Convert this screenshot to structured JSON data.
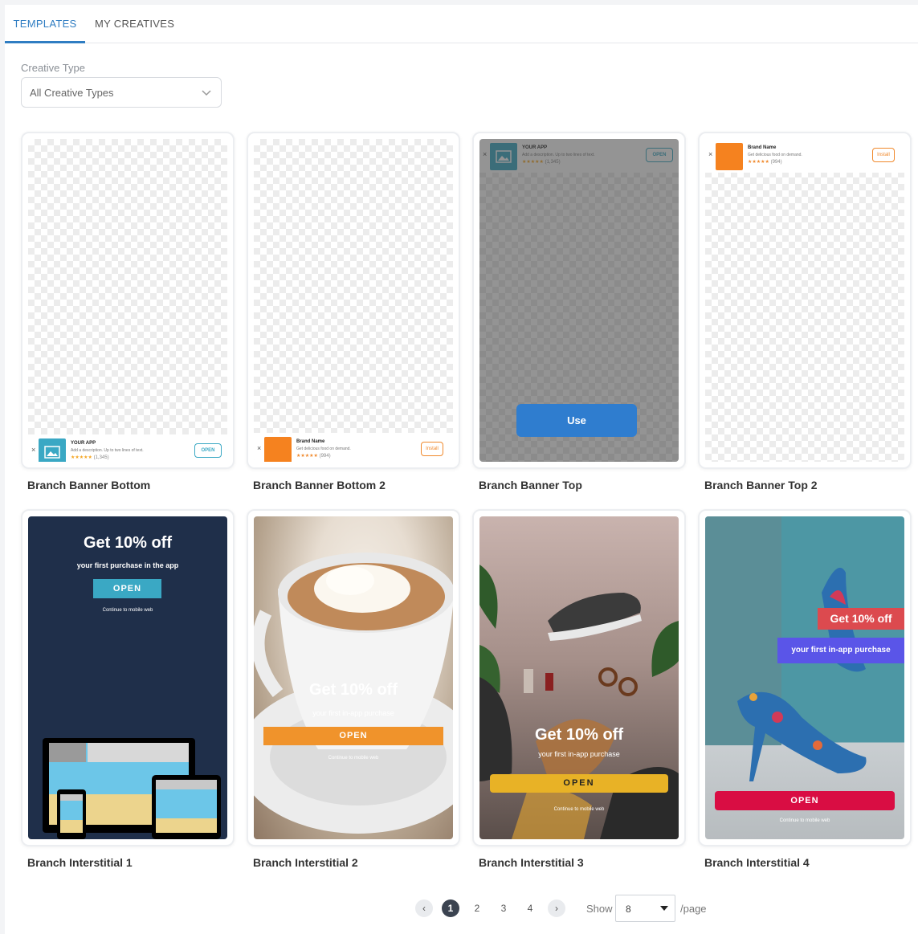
{
  "tabs": [
    {
      "label": "TEMPLATES",
      "active": true
    },
    {
      "label": "MY CREATIVES",
      "active": false
    }
  ],
  "filter": {
    "label": "Creative Type",
    "value": "All Creative Types"
  },
  "banners": {
    "your_app": {
      "close": "×",
      "name": "YOUR APP",
      "desc": "Add a description. Up to two lines of text.",
      "stars": "★★★★★",
      "count": "(1,345)",
      "button": "OPEN"
    },
    "brand": {
      "close": "×",
      "name": "Brand Name",
      "desc": "Get delicious food on demand.",
      "stars": "★★★★★",
      "count": "(994)",
      "button": "Install"
    }
  },
  "use_button": "Use",
  "templates": [
    {
      "title": "Branch Banner Bottom"
    },
    {
      "title": "Branch Banner Bottom 2"
    },
    {
      "title": "Branch Banner Top"
    },
    {
      "title": "Branch Banner Top 2"
    },
    {
      "title": "Branch Interstitial 1",
      "headline": "Get 10% off",
      "sub": "your first purchase in the app",
      "cta": "OPEN",
      "link": "Continue to mobile web"
    },
    {
      "title": "Branch Interstitial 2",
      "headline": "Get 10% off",
      "sub": "your first in-app purchase",
      "cta": "OPEN",
      "link": "Continue to mobile web"
    },
    {
      "title": "Branch Interstitial 3",
      "headline": "Get 10% off",
      "sub": "your first in-app purchase",
      "cta": "OPEN",
      "link": "Continue to mobile web"
    },
    {
      "title": "Branch Interstitial 4",
      "headline": "Get 10% off",
      "sub": "your first in-app purchase",
      "cta": "OPEN",
      "link": "Continue to mobile web"
    }
  ],
  "pagination": {
    "pages": [
      "1",
      "2",
      "3",
      "4"
    ],
    "current": "1",
    "prev": "‹",
    "next": "›",
    "show_label": "Show",
    "per_page": "8",
    "per_page_suffix": "/page"
  },
  "colors": {
    "accent": "#2f7dc2",
    "use_button": "#2f7dcf",
    "interstitial1_bg": "#1f2f4a",
    "interstitial1_cta": "#3aa8c4",
    "interstitial2_cta": "#f0932b",
    "interstitial3_cta": "#e8b226",
    "interstitial4_cta": "#d90d43",
    "banner_brand_logo": "#f5821f",
    "banner_app_logo": "#3aa8c4"
  }
}
